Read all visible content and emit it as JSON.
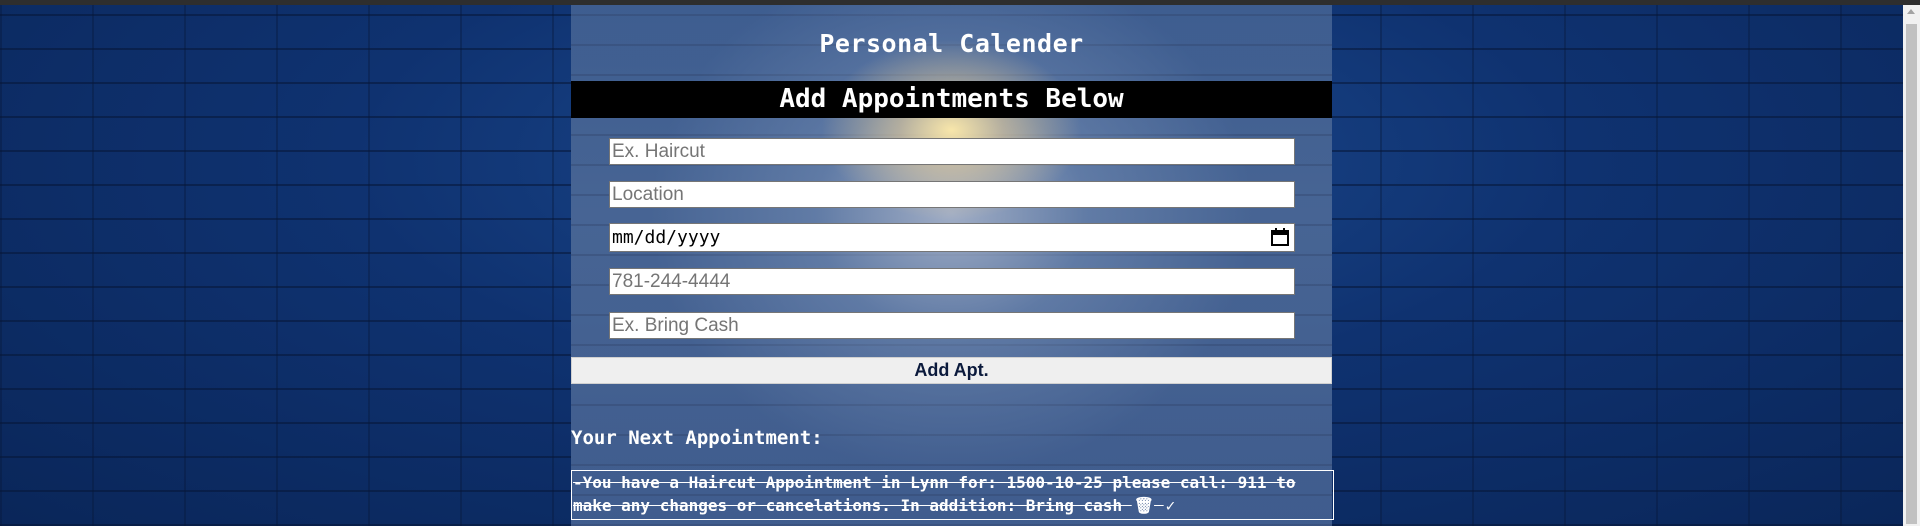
{
  "page": {
    "title": "Personal Calender",
    "section_header": "Add Appointments Below"
  },
  "form": {
    "appointment_placeholder": "Ex. Haircut",
    "location_placeholder": "Location",
    "date_placeholder": "mm/dd/yyyy",
    "phone_placeholder": "781-244-4444",
    "notes_placeholder": "Ex. Bring Cash",
    "add_button_label": "Add Apt."
  },
  "next_appointment": {
    "label": "Your Next Appointment:",
    "text": "-You have a Haircut Appointment in Lynn for: 1500-10-25 please call: 911 to make any changes or cancelations. In addition: Bring cash",
    "delete_glyph": "🗑",
    "done_glyph": "✓"
  },
  "colors": {
    "page_background": "#0e2d63",
    "header_bar": "#000000",
    "button_background": "#efefef",
    "button_text": "#0b1a3c"
  },
  "icons": [
    "calendar-icon",
    "trash-icon",
    "checkmark-icon"
  ]
}
